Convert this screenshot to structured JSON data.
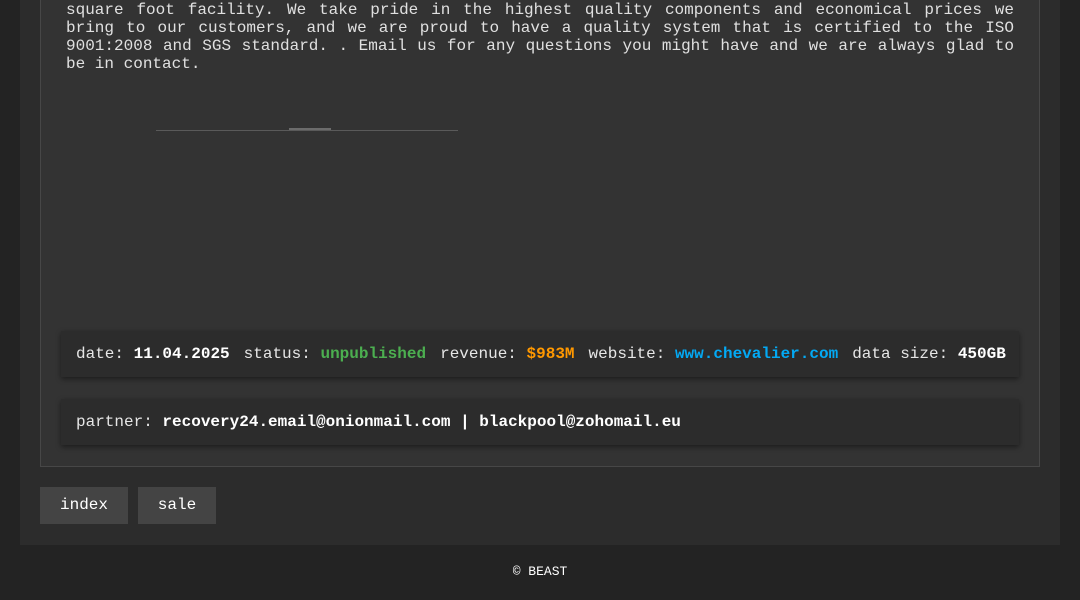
{
  "description": "square foot facility. We take pride in the highest quality components and economical prices we bring to our customers, and we are proud to have a quality system that is certified to the ISO 9001:2008 and SGS standard. . Email us for any questions you might have and we are always glad to be in contact.",
  "meta": {
    "date_label": "date:",
    "date_value": "11.04.2025",
    "status_label": "status:",
    "status_value": "unpublished",
    "revenue_label": "revenue:",
    "revenue_value": "$983M",
    "website_label": "website:",
    "website_value": "www.chevalier.com",
    "data_size_label": "data size:",
    "data_size_value": "450GB"
  },
  "partner": {
    "label": "partner:",
    "value": "recovery24.email@onionmail.com | blackpool@zohomail.eu"
  },
  "nav": {
    "index_label": "index",
    "sale_label": "sale"
  },
  "footer": {
    "text": "© BEAST"
  },
  "colors": {
    "status": "#4caf50",
    "revenue": "#ff9800",
    "website": "#03a9f4"
  }
}
